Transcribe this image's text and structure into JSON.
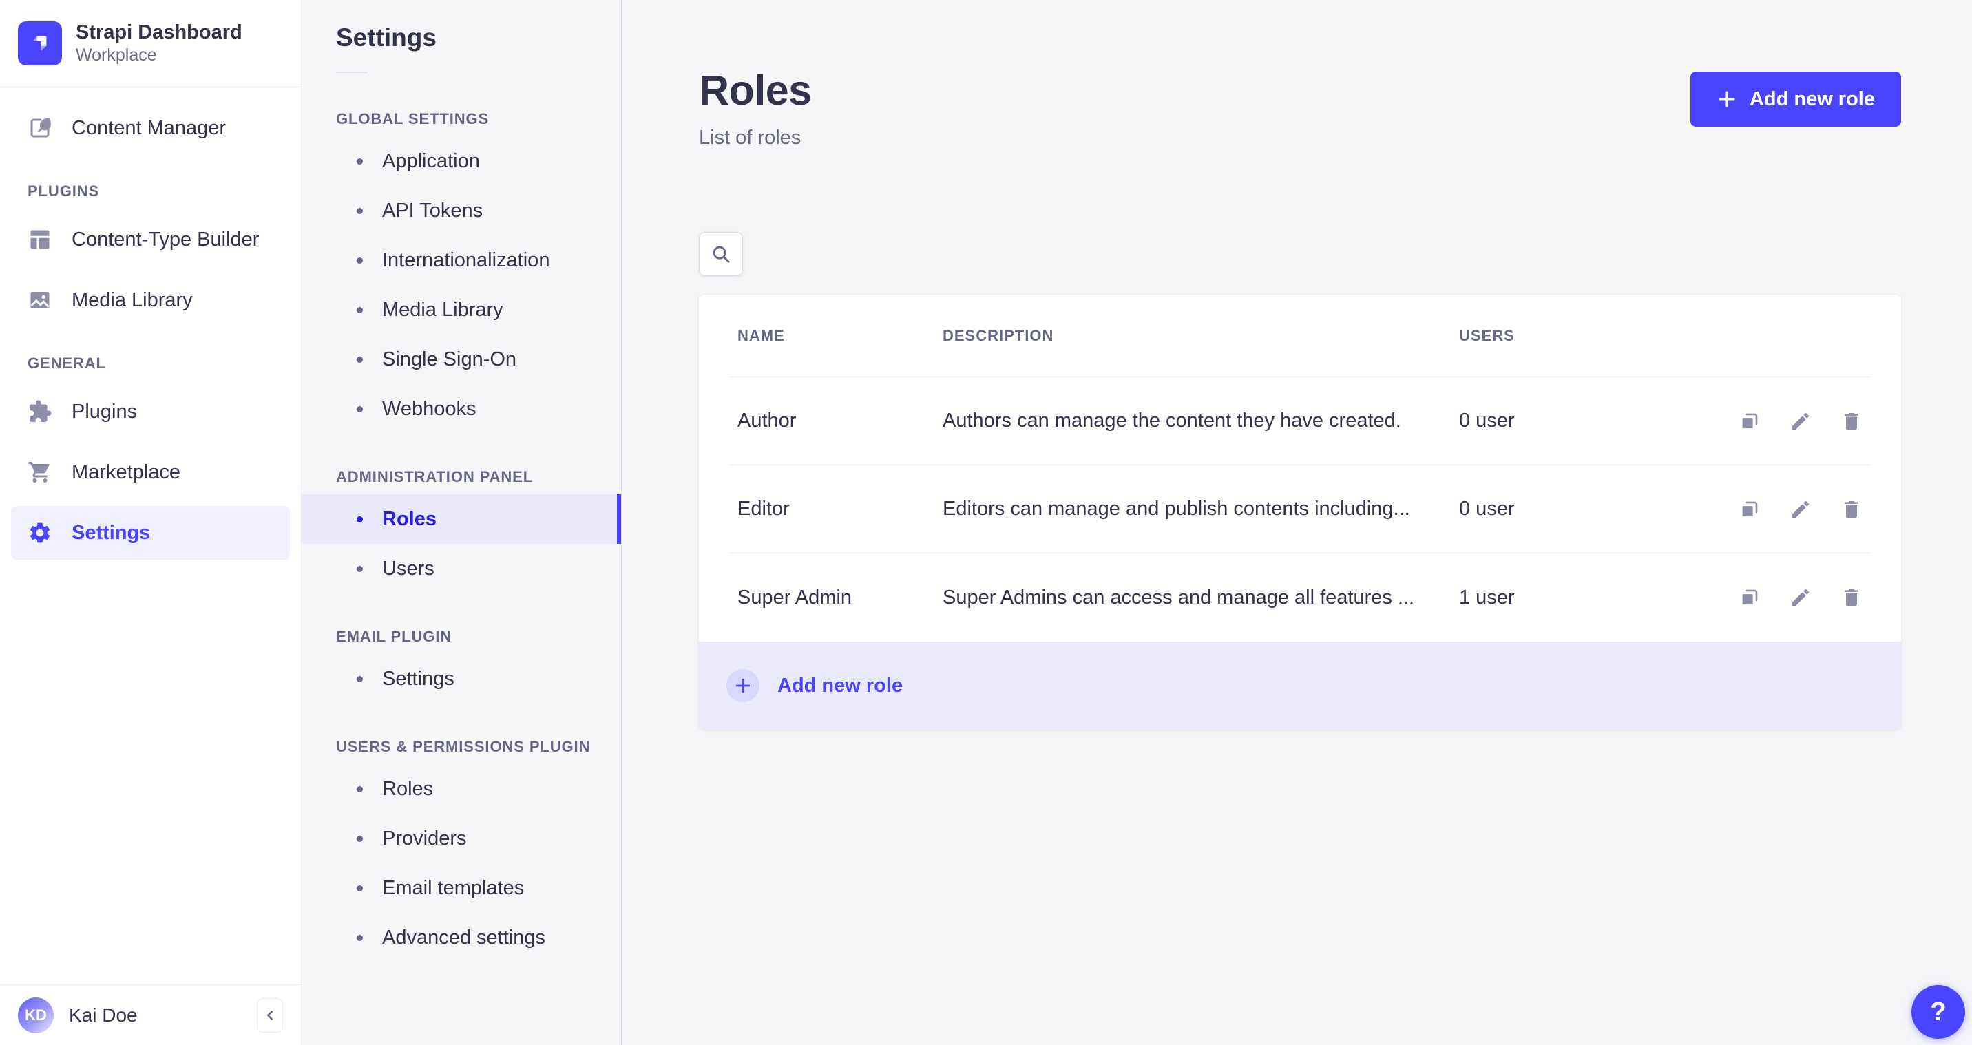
{
  "brand": {
    "title": "Strapi Dashboard",
    "subtitle": "Workplace"
  },
  "sidebar": {
    "content_manager": "Content Manager",
    "sections": [
      {
        "label": "PLUGINS",
        "items": [
          {
            "label": "Content-Type Builder"
          },
          {
            "label": "Media Library"
          }
        ]
      },
      {
        "label": "GENERAL",
        "items": [
          {
            "label": "Plugins"
          },
          {
            "label": "Marketplace"
          },
          {
            "label": "Settings"
          }
        ]
      }
    ],
    "user": {
      "initials": "KD",
      "name": "Kai Doe"
    }
  },
  "subnav": {
    "title": "Settings",
    "active_item": "Roles",
    "groups": [
      {
        "label": "GLOBAL SETTINGS",
        "items": [
          "Application",
          "API Tokens",
          "Internationalization",
          "Media Library",
          "Single Sign-On",
          "Webhooks"
        ]
      },
      {
        "label": "ADMINISTRATION PANEL",
        "items": [
          "Roles",
          "Users"
        ]
      },
      {
        "label": "EMAIL PLUGIN",
        "items": [
          "Settings"
        ]
      },
      {
        "label": "USERS & PERMISSIONS PLUGIN",
        "items": [
          "Roles",
          "Providers",
          "Email templates",
          "Advanced settings"
        ]
      }
    ]
  },
  "main": {
    "title": "Roles",
    "subtitle": "List of roles",
    "add_button": "Add new role",
    "help_label": "?",
    "table": {
      "headers": [
        "NAME",
        "DESCRIPTION",
        "USERS"
      ],
      "rows": [
        {
          "name": "Author",
          "description": "Authors can manage the content they have created.",
          "users": "0 user"
        },
        {
          "name": "Editor",
          "description": "Editors can manage and publish contents including...",
          "users": "0 user"
        },
        {
          "name": "Super Admin",
          "description": "Super Admins can access and manage all features ...",
          "users": "1 user"
        }
      ],
      "footer_add": "Add new role"
    }
  },
  "colors": {
    "accent": "#4945ff",
    "active_text": "#271fe0",
    "text": "#32324d",
    "muted": "#666687",
    "icon": "#8e8ea9",
    "background": "#f6f6f9",
    "card": "#ffffff",
    "footer_row_bg": "#eaeafc",
    "active_bg": "#e9e9fb",
    "border": "#eaeaef"
  },
  "icons": [
    "strapi-logo-icon",
    "content-manager-icon",
    "content-type-builder-icon",
    "media-library-icon",
    "plugins-icon",
    "marketplace-icon",
    "settings-icon",
    "chevron-left-icon",
    "search-icon",
    "plus-icon",
    "duplicate-icon",
    "edit-icon",
    "delete-icon",
    "question-mark-icon"
  ]
}
